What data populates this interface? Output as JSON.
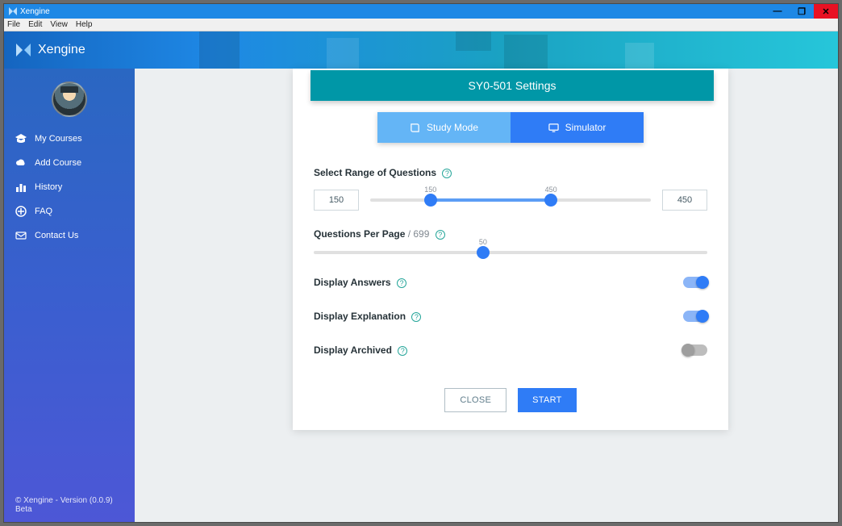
{
  "window": {
    "title": "Xengine"
  },
  "menu": {
    "file": "File",
    "edit": "Edit",
    "view": "View",
    "help": "Help"
  },
  "app": {
    "title": "Xengine"
  },
  "sidebar": {
    "items": [
      {
        "label": "My Courses",
        "icon": "graduation"
      },
      {
        "label": "Add Course",
        "icon": "cloud"
      },
      {
        "label": "History",
        "icon": "bar-chart"
      },
      {
        "label": "FAQ",
        "icon": "plus-circle"
      },
      {
        "label": "Contact Us",
        "icon": "mail"
      }
    ],
    "footer": "© Xengine - Version (0.0.9) Beta"
  },
  "settings": {
    "title": "SY0-501 Settings",
    "tabs": {
      "study": "Study Mode",
      "simulator": "Simulator",
      "active": "study"
    },
    "range": {
      "label": "Select Range of Questions",
      "min_value": "150",
      "max_value": "450",
      "min_hint": "150",
      "max_hint": "450",
      "total": 699,
      "min_pct": 21.5,
      "max_pct": 64.4
    },
    "per_page": {
      "label_a": "Questions Per Page",
      "label_b": " / 699",
      "value": 50,
      "hint": "50",
      "pct": 43
    },
    "toggles": {
      "answers": {
        "label": "Display Answers",
        "on": true
      },
      "explanation": {
        "label": "Display Explanation",
        "on": true
      },
      "archived": {
        "label": "Display Archived",
        "on": false
      }
    },
    "buttons": {
      "close": "CLOSE",
      "start": "START"
    }
  }
}
